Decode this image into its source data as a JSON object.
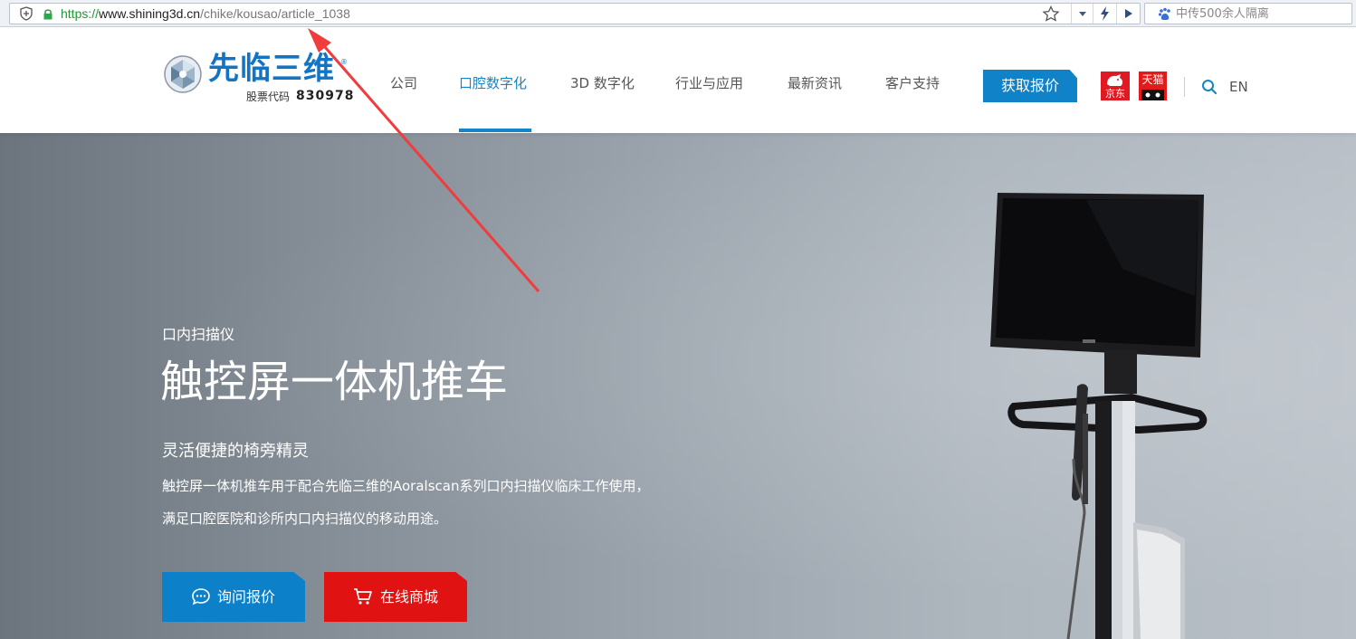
{
  "browser": {
    "url_scheme": "https://",
    "url_host": "www.shining3d.cn",
    "url_path": "/chike/kousao/article_1038",
    "search_text": "中传500余人隔离"
  },
  "header": {
    "logo": {
      "name": "先临三维",
      "registered_mark": "®",
      "stock_label": "股票代码",
      "stock_code": "830978"
    },
    "nav": [
      {
        "label": "公司",
        "active": false
      },
      {
        "label": "口腔数字化",
        "active": true
      },
      {
        "label": "3D 数字化",
        "active": false
      },
      {
        "label": "行业与应用",
        "active": false
      },
      {
        "label": "最新资讯",
        "active": false
      },
      {
        "label": "客户支持",
        "active": false
      }
    ],
    "quote_button": "获取报价",
    "jd_label": "京东",
    "tmall_label": "天猫",
    "language": "EN"
  },
  "hero": {
    "category": "口内扫描仪",
    "title": "触控屏一体机推车",
    "subtitle": "灵活便捷的椅旁精灵",
    "description_line1": "触控屏一体机推车用于配合先临三维的Aoralscan系列口内扫描仪临床工作使用，",
    "description_line2": "满足口腔医院和诊所内口内扫描仪的移动用途。",
    "inquire_button": "询问报价",
    "shop_button": "在线商城"
  },
  "colors": {
    "brand_blue": "#1486c8",
    "shop_red": "#e01212",
    "annotation_arrow": "#f03c3c"
  },
  "icons": [
    "shield-icon",
    "lock-icon",
    "star-icon",
    "dropdown-icon",
    "lightning-icon",
    "play-icon",
    "paw-icon",
    "search-icon",
    "chat-icon",
    "cart-icon"
  ]
}
